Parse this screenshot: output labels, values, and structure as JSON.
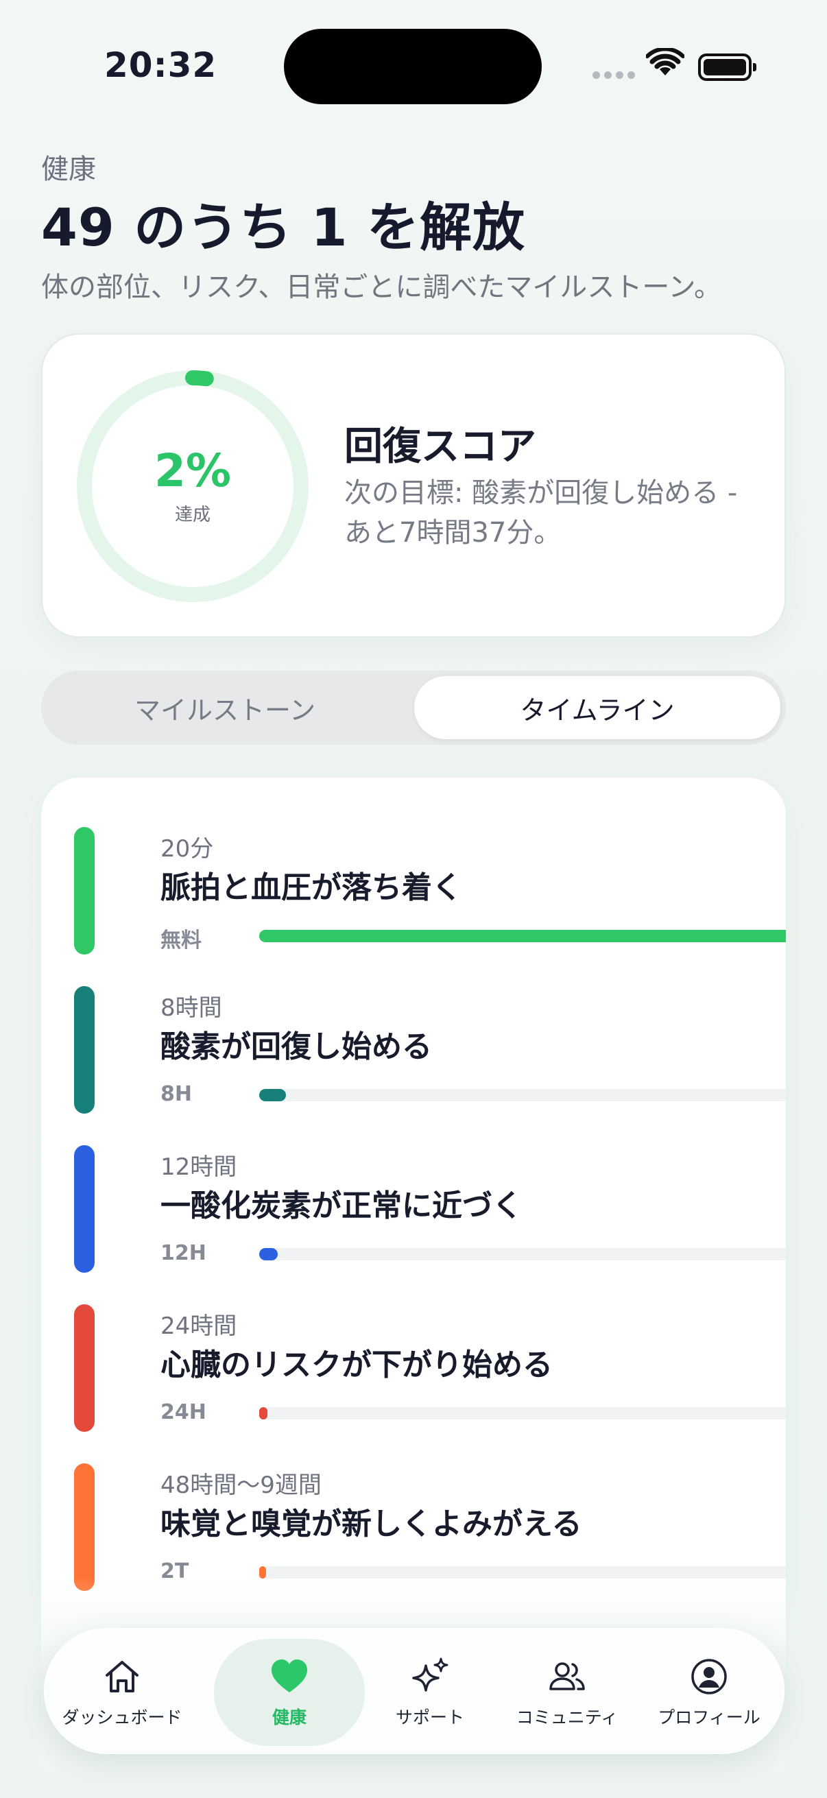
{
  "status_bar": {
    "time": "20:32"
  },
  "header": {
    "eyebrow": "健康",
    "title": "49 のうち 1 を解放",
    "subtitle": "体の部位、リスク、日常ごとに調べたマイルストーン。"
  },
  "score": {
    "percent_label": "2%",
    "progress": 0.02,
    "sub_label": "達成",
    "title": "回復スコア",
    "desc_line1": "次の目標: 酸素が回復し始める -",
    "desc_line2": "あと7時間37分。"
  },
  "tabs": {
    "milestones": "マイルストーン",
    "timeline": "タイムライン"
  },
  "timeline": [
    {
      "time": "20分",
      "title": "脈拍と血圧が落ち着く",
      "badge": "無料",
      "color": "#2ec866",
      "progress": 1.0
    },
    {
      "time": "8時間",
      "title": "酸素が回復し始める",
      "badge": "8H",
      "color": "#17807a",
      "progress": 0.05
    },
    {
      "time": "12時間",
      "title": "一酸化炭素が正常に近づく",
      "badge": "12H",
      "color": "#2b60e0",
      "progress": 0.035
    },
    {
      "time": "24時間",
      "title": "心臓のリスクが下がり始める",
      "badge": "24H",
      "color": "#e44a3c",
      "progress": 0.016
    },
    {
      "time": "48時間〜9週間",
      "title": "味覚と嗅覚が新しくよみがえる",
      "badge": "2T",
      "color": "#ff7436",
      "progress": 0.008
    }
  ],
  "nav": {
    "dashboard": "ダッシュボード",
    "health": "健康",
    "support": "サポート",
    "community": "コミュニティ",
    "profile": "プロフィール"
  }
}
